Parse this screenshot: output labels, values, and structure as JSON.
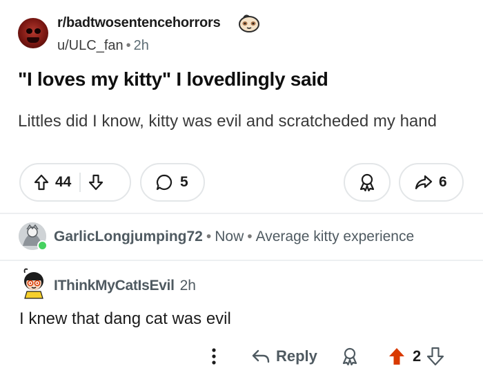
{
  "post": {
    "subreddit": "r/badtwosentencehorrors",
    "author": "u/ULC_fan",
    "time": "2h",
    "title": "\"I loves my kitty\" I lovedlingly said",
    "body": "Littles did I know, kitty was evil and scratcheded my hand",
    "upvotes": "44",
    "comments": "5",
    "shares": "6"
  },
  "comments": [
    {
      "username": "GarlicLongjumping72",
      "time": "Now",
      "text": "Average kitty experience"
    },
    {
      "username": "IThinkMyCatIsEvil",
      "time": "2h",
      "text": "I knew that dang cat was evil",
      "reply_label": "Reply",
      "score": "2"
    }
  ],
  "colors": {
    "accent_upvote": "#d93a00",
    "online": "#46d160",
    "meta_text": "#4f5a61",
    "border": "#e3e6e8"
  },
  "icons": [
    "sloth-icon",
    "upvote-icon",
    "downvote-icon",
    "comment-icon",
    "award-icon",
    "share-icon",
    "more-icon",
    "reply-icon"
  ]
}
